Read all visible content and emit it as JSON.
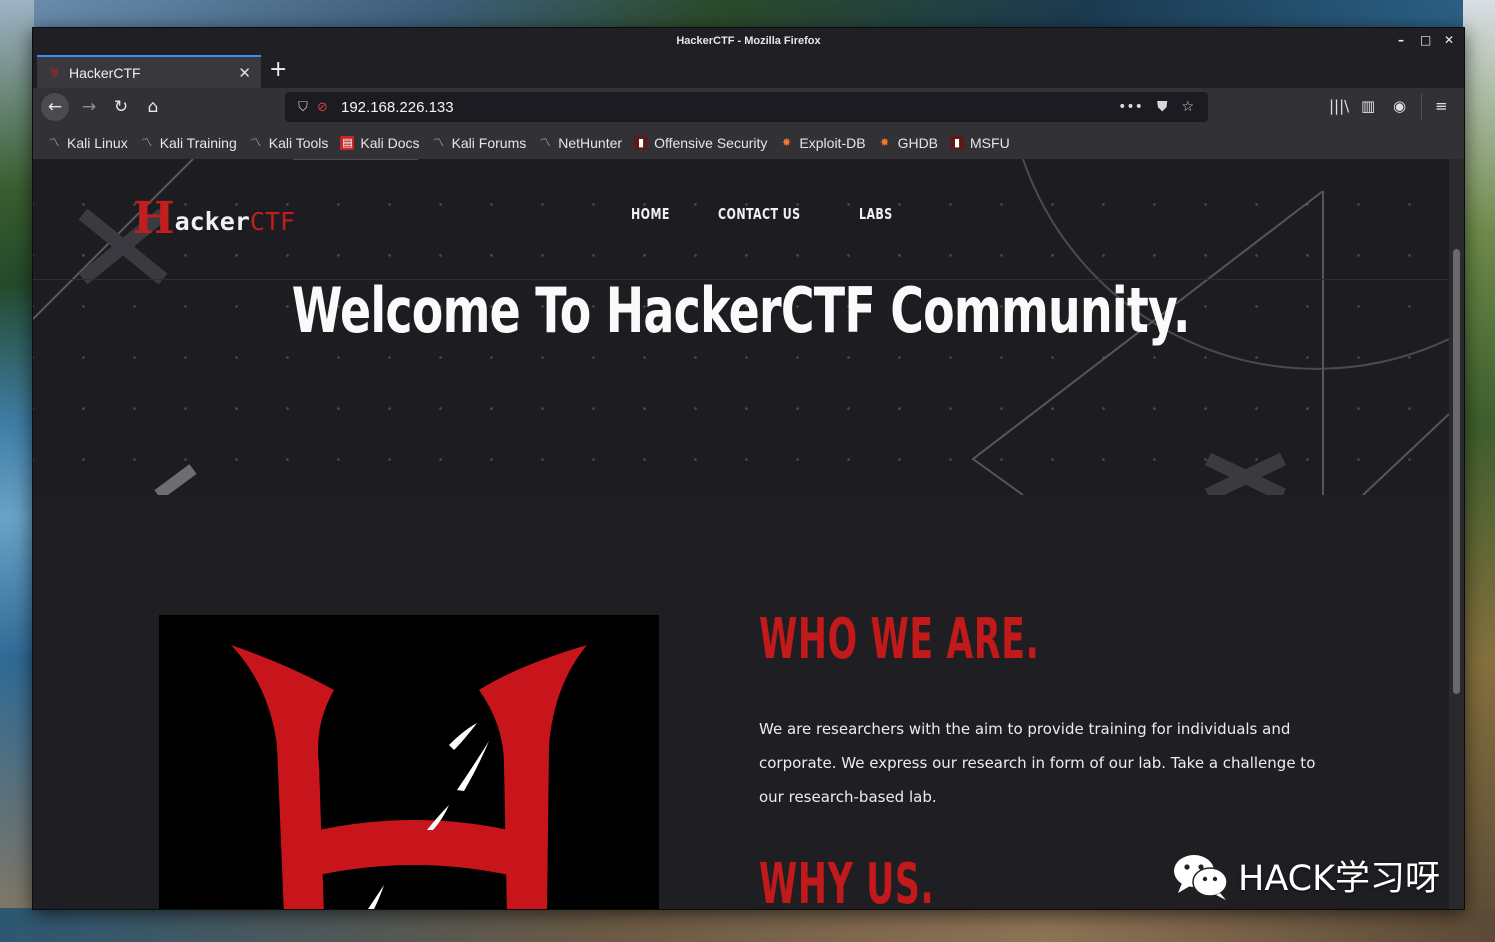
{
  "window": {
    "title": "HackerCTF - Mozilla Firefox",
    "controls": [
      "–",
      "□",
      "✕"
    ]
  },
  "tab": {
    "title": "HackerCTF",
    "close": "✕",
    "new_tab": "+"
  },
  "urlbar": {
    "url": "192.168.226.133",
    "more": "•••"
  },
  "bookmarks": [
    {
      "label": "Kali Linux",
      "icon": "kali-dragon-icon"
    },
    {
      "label": "Kali Training",
      "icon": "kali-dragon-icon"
    },
    {
      "label": "Kali Tools",
      "icon": "kali-dragon-icon"
    },
    {
      "label": "Kali Docs",
      "icon": "kali-docs-icon"
    },
    {
      "label": "Kali Forums",
      "icon": "kali-dragon-icon"
    },
    {
      "label": "NetHunter",
      "icon": "nethunter-icon"
    },
    {
      "label": "Offensive Security",
      "icon": "offsec-icon"
    },
    {
      "label": "Exploit-DB",
      "icon": "exploit-db-icon"
    },
    {
      "label": "GHDB",
      "icon": "ghdb-icon"
    },
    {
      "label": "MSFU",
      "icon": "msfu-icon"
    }
  ],
  "site": {
    "logo": {
      "h": "H",
      "acker": "acker",
      "ctf": "CTF"
    },
    "nav": [
      "HOME",
      "CONTACT US",
      "LABS"
    ],
    "hero_title": "Welcome To HackerCTF Community.",
    "who_title": "WHO WE ARE.",
    "who_text": "We are researchers with the aim to provide training for individuals and corporate. We express our research in form of our lab. Take a challenge to our research-based lab.",
    "why_title": "WHY US."
  },
  "watermark": {
    "text": "HACK学习呀"
  },
  "colors": {
    "accent": "#c21e1e",
    "tab_highlight": "#3a8ff7",
    "background": "#1d1d21"
  }
}
